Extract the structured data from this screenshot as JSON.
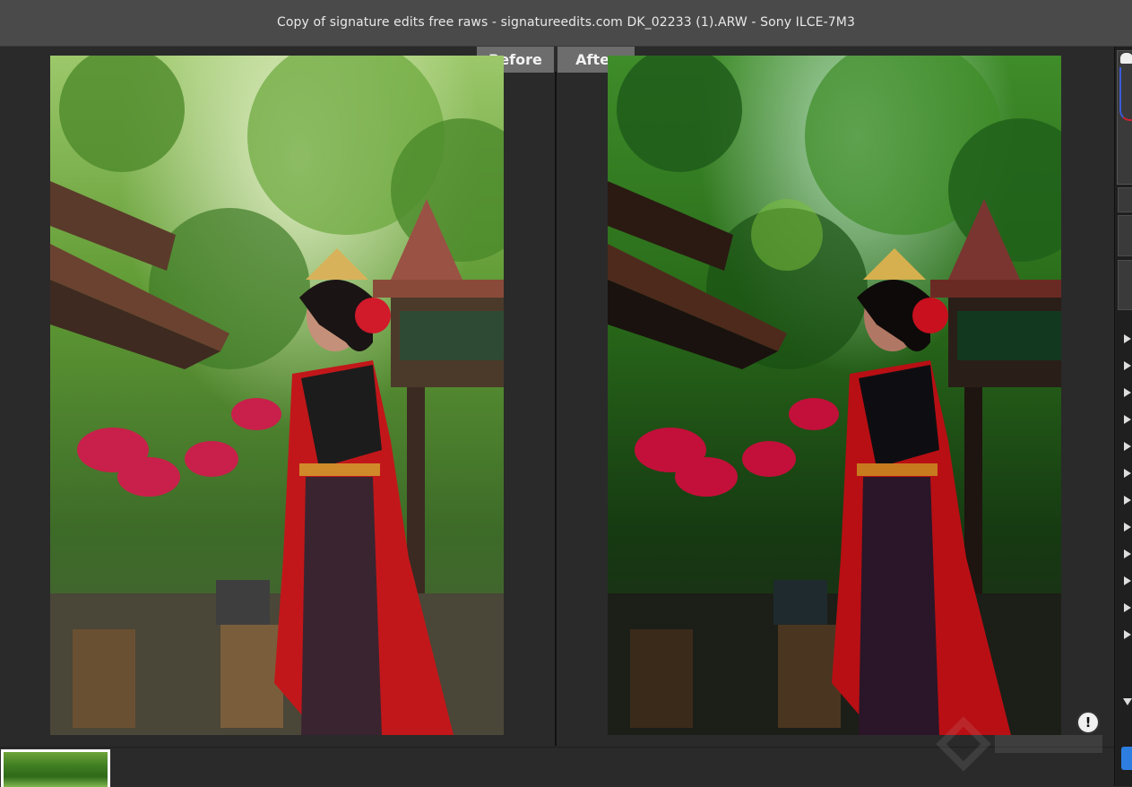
{
  "window": {
    "title": "Copy of signature edits free raws - signatureedits.com DK_02233 (1).ARW  -  Sony ILCE-7M3"
  },
  "compare": {
    "before_label": "Before",
    "after_label": "After"
  },
  "viewer": {
    "warning_glyph": "!"
  },
  "right_panel": {
    "icons": [
      "cloud-icon",
      "chevron-right-icon",
      "chevron-down-icon"
    ]
  },
  "colors": {
    "titlebar_bg": "#4a4a4a",
    "viewer_bg": "#2a2a2a",
    "tab_bg": "#6d6d6d",
    "accent_blue": "#2d7ee0"
  }
}
